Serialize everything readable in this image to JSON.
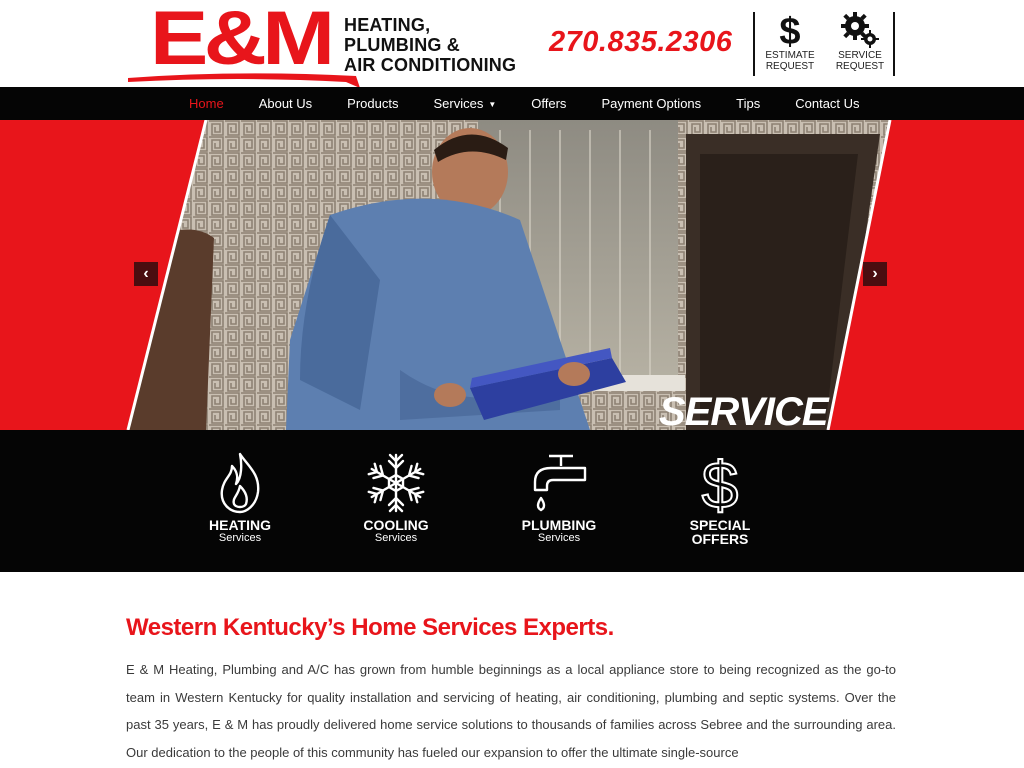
{
  "header": {
    "logo_em": "E&M",
    "logo_lines": [
      "HEATING,",
      "PLUMBING &",
      "AIR CONDITIONING"
    ],
    "phone": "270.835.2306",
    "buttons": [
      {
        "icon": "dollar-icon",
        "label_line1": "ESTIMATE",
        "label_line2": "REQUEST"
      },
      {
        "icon": "gears-icon",
        "label_line1": "SERVICE",
        "label_line2": "REQUEST"
      }
    ]
  },
  "nav": {
    "items": [
      {
        "label": "Home",
        "active": true
      },
      {
        "label": "About Us"
      },
      {
        "label": "Products"
      },
      {
        "label": "Services",
        "has_dropdown": true
      },
      {
        "label": "Offers"
      },
      {
        "label": "Payment Options"
      },
      {
        "label": "Tips"
      },
      {
        "label": "Contact Us"
      }
    ]
  },
  "hero": {
    "caption": "SERVICE",
    "prev_label": "‹",
    "next_label": "›"
  },
  "services": [
    {
      "icon": "flame-icon",
      "title": "HEATING",
      "subtitle": "Services"
    },
    {
      "icon": "snowflake-icon",
      "title": "COOLING",
      "subtitle": "Services"
    },
    {
      "icon": "faucet-icon",
      "title": "PLUMBING",
      "subtitle": "Services"
    },
    {
      "icon": "dollar-icon",
      "title": "SPECIAL",
      "subtitle": "OFFERS"
    }
  ],
  "content": {
    "headline": "Western Kentucky’s Home Services Experts.",
    "body": "E & M Heating, Plumbing and A/C has grown from humble beginnings as a local appliance store to being recognized as the go-to team in Western Kentucky for quality installation and servicing of heating, air conditioning, plumbing and septic systems. Over the past 35 years, E & M has proudly delivered home service solutions to thousands of families across Sebree and the surrounding area. Our dedication to the people of this community has fueled our expansion to offer the ultimate single-source"
  },
  "colors": {
    "brand_red": "#e8151b",
    "nav_bg": "#050505",
    "text": "#3a3a3a"
  }
}
